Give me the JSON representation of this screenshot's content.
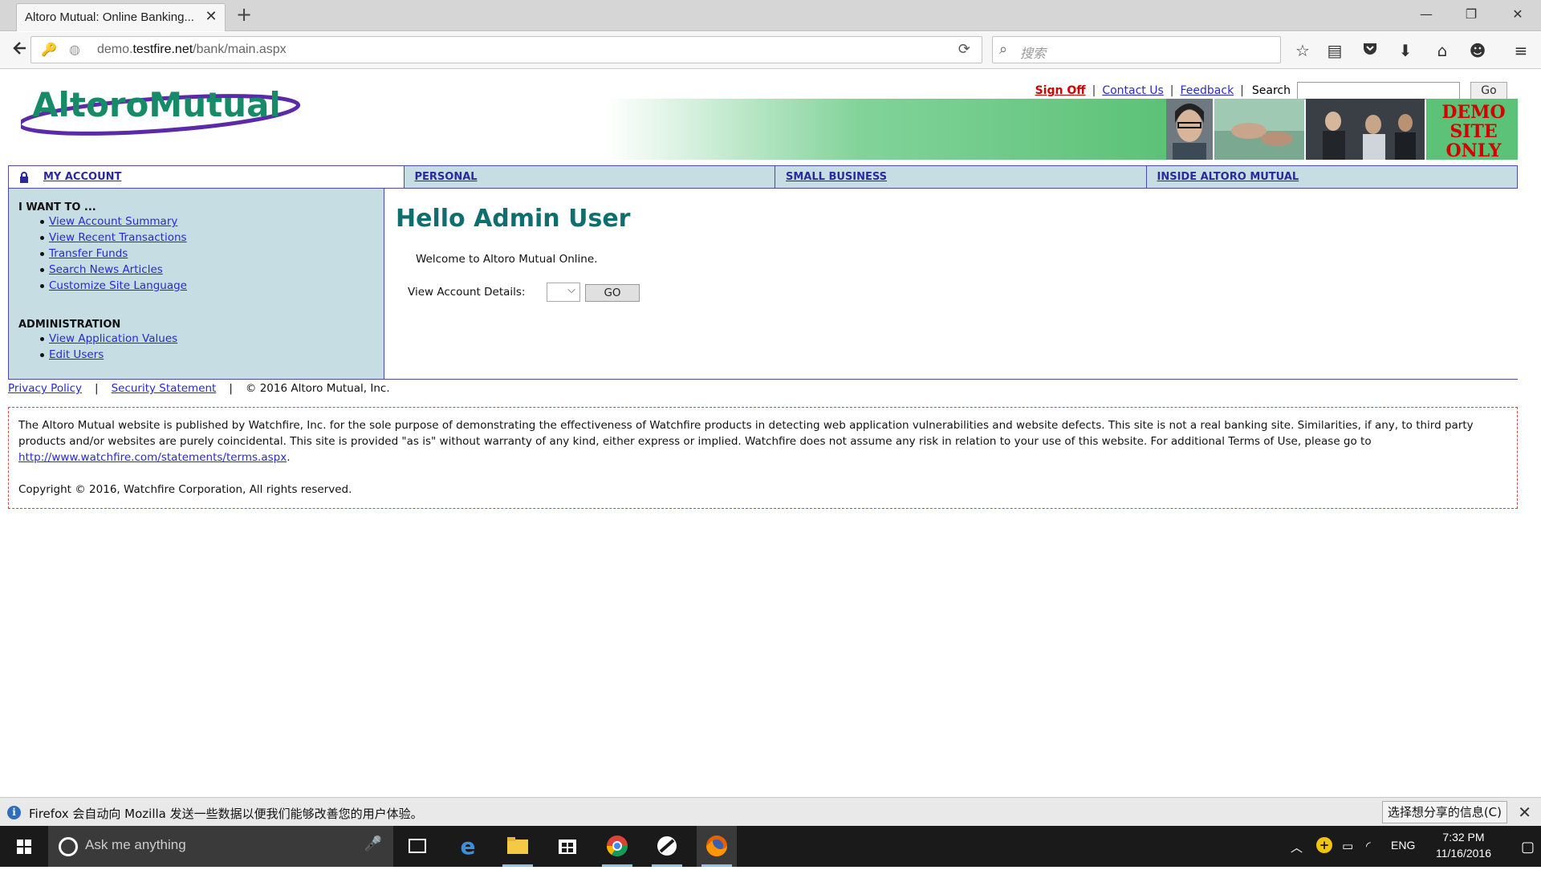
{
  "browser": {
    "tab_title": "Altoro Mutual: Online Banking...",
    "url_domain": "demo.",
    "url_host": "testfire.net",
    "url_path": "/bank/main.aspx",
    "search_placeholder": "搜索"
  },
  "site": {
    "logo_text": "AltoroMutual",
    "banner_text": "DEMO SITE ONLY",
    "top_links": {
      "sign_off": "Sign Off",
      "contact_us": "Contact Us",
      "feedback": "Feedback",
      "separator": "|",
      "search_label": "Search",
      "go_label": "Go"
    },
    "nav_tabs": [
      {
        "label": "MY ACCOUNT"
      },
      {
        "label": "PERSONAL"
      },
      {
        "label": "SMALL BUSINESS"
      },
      {
        "label": "INSIDE ALTORO MUTUAL"
      }
    ],
    "sidebar": {
      "section1_title": "I WANT TO ...",
      "section1_links": [
        "View Account Summary",
        "View Recent Transactions",
        "Transfer Funds",
        "Search News Articles",
        "Customize Site Language"
      ],
      "section2_title": "ADMINISTRATION",
      "section2_links": [
        "View Application Values",
        "Edit Users"
      ]
    },
    "main": {
      "greeting": "Hello Admin User",
      "welcome": "Welcome to Altoro Mutual Online.",
      "account_details_label": "View Account Details:",
      "go_label": "GO"
    },
    "footer": {
      "privacy": "Privacy Policy",
      "security": "Security Statement",
      "separator": "|",
      "copyright": "© 2016 Altoro Mutual, Inc."
    },
    "disclaimer": {
      "text_pre": "The Altoro Mutual website is published by Watchfire, Inc. for the sole purpose of demonstrating the effectiveness of Watchfire products in detecting web application vulnerabilities and website defects. This site is not a real banking site. Similarities, if any, to third party products and/or websites are purely coincidental. This site is provided \"as is\" without warranty of any kind, either express or implied. Watchfire does not assume any risk in relation to your use of this website. For additional Terms of Use, please go to ",
      "link": "http://www.watchfire.com/statements/terms.aspx",
      "text_post": ".",
      "copyright": "Copyright © 2016, Watchfire Corporation, All rights reserved."
    }
  },
  "notification": {
    "message": "Firefox 会自动向 Mozilla 发送一些数据以便我们能够改善您的用户体验。",
    "button": "选择想分享的信息(C)"
  },
  "taskbar": {
    "search_placeholder": "Ask me anything",
    "lang": "ENG",
    "time": "7:32 PM",
    "date": "11/16/2016"
  },
  "colors": {
    "greeting": "#0f6e6e",
    "nav_bg": "#c5dde3",
    "nav_border": "#4a4aa0",
    "sign_off": "#d40000",
    "link": "#2a2acc"
  }
}
